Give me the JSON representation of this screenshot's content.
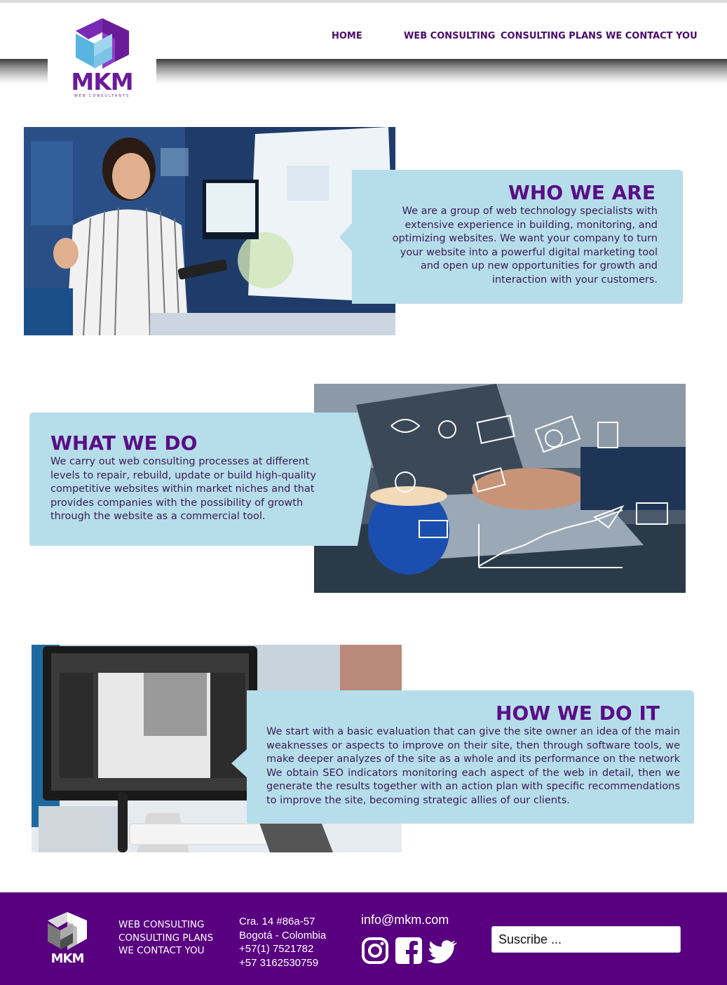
{
  "brand": {
    "name": "MKM",
    "tagline": "WEB CONSULTANTS",
    "colors": {
      "primary": "#58007f",
      "accent": "#6a1b9a",
      "card": "#b6deea"
    }
  },
  "nav": {
    "items": [
      "HOME",
      "WEB CONSULTING",
      "CONSULTING PLANS",
      "WE CONTACT YOU"
    ]
  },
  "sections": {
    "who": {
      "title": "WHO WE ARE",
      "body": "We are a group of web technology specialists with extensive experience in building, monitoring, and optimizing websites. We want your company to turn your website into a powerful digital marketing tool and open up new opportunities for growth and interaction with your customers."
    },
    "what": {
      "title": "WHAT WE DO",
      "body": "We carry out web consulting processes at different levels to repair, rebuild, update or build high-quality competitive websites within market niches and that provides companies with the possibility of growth through the website as a commercial tool."
    },
    "how": {
      "title": "HOW WE DO IT",
      "body": "We start with a basic evaluation that can give the site owner an idea of the main weaknesses or aspects to improve on their site, then through software tools, we make deeper analyzes of the site as a whole and its performance on the network We obtain SEO indicators monitoring each aspect of the web in detail, then we generate the results together with an action plan with specific recommendations to improve the site, becoming strategic allies of our clients."
    }
  },
  "footer": {
    "links": [
      "WEB CONSULTING",
      "CONSULTING PLANS",
      "WE CONTACT YOU"
    ],
    "address": [
      "Cra. 14 #86a-57",
      "Bogotá - Colombia",
      "+57(1) 7521782",
      "+57  3162530759"
    ],
    "email": "info@mkm.com",
    "social": [
      "instagram-icon",
      "facebook-icon",
      "twitter-icon"
    ],
    "subscribe_placeholder": "Suscribe ..."
  }
}
